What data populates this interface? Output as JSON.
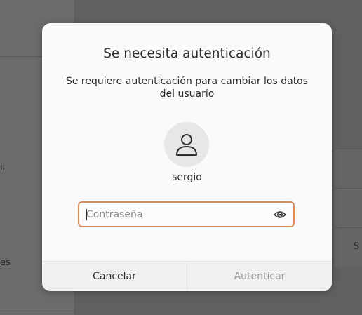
{
  "background": {
    "left_fragments": [
      "il",
      "es"
    ],
    "right_fragment": "S"
  },
  "dialog": {
    "title": "Se necesita autenticación",
    "message": "Se requiere autenticación para cambiar los datos del usuario",
    "username": "sergio",
    "password": {
      "value": "",
      "placeholder": "Contraseña"
    },
    "buttons": {
      "cancel": "Cancelar",
      "authenticate": "Autenticar"
    },
    "icons": {
      "avatar": "user-avatar-icon",
      "reveal": "eye-icon"
    }
  },
  "colors": {
    "focus_border": "#e08a5b",
    "disabled_text": "#9c9c9c",
    "dialog_bg": "#fafafa"
  }
}
